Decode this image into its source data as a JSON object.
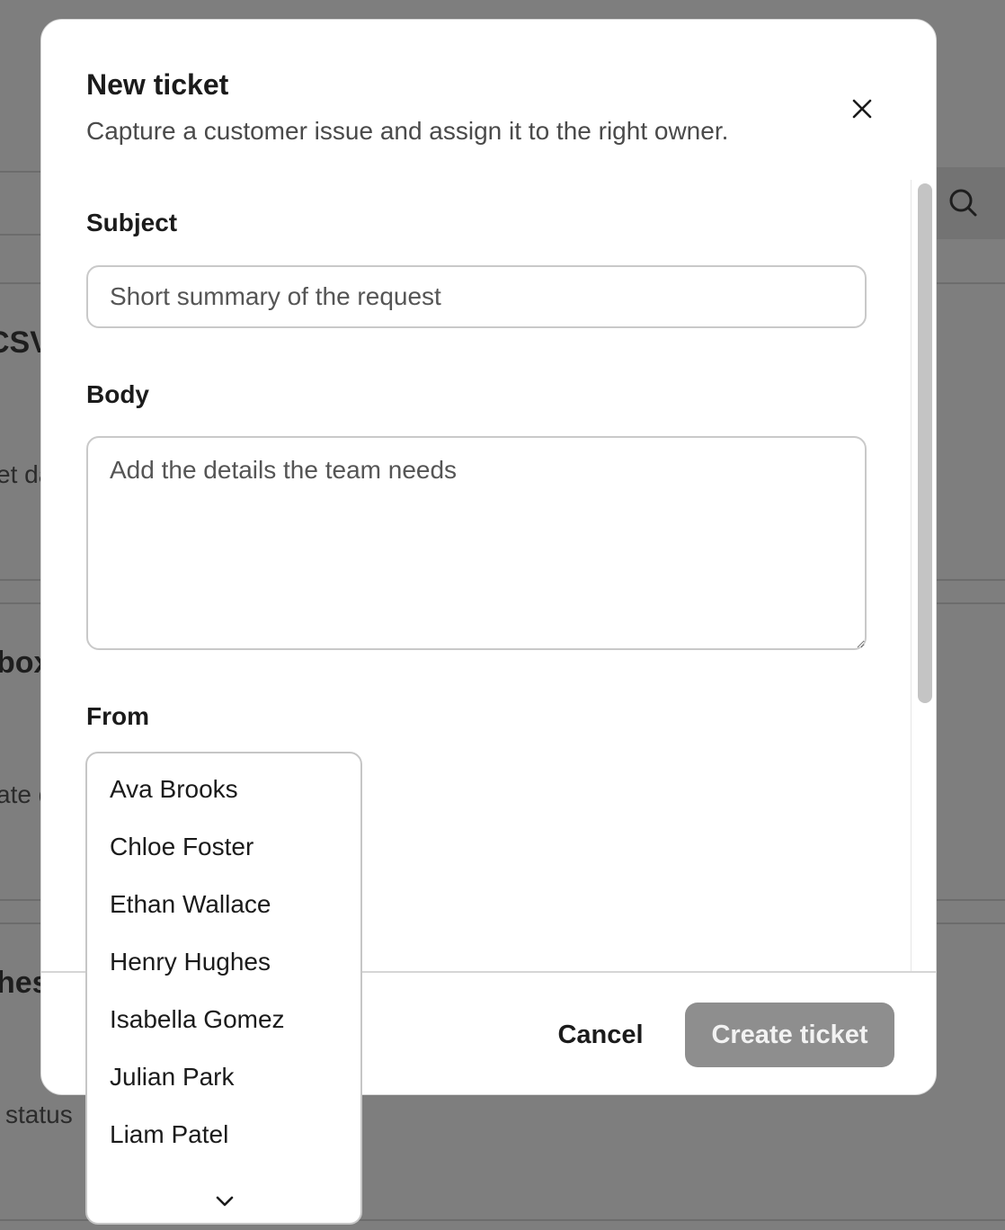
{
  "background": {
    "fragments": [
      "CSV",
      "et da",
      "box",
      "ate d",
      "hes",
      "status"
    ]
  },
  "modal": {
    "title": "New ticket",
    "subtitle": "Capture a customer issue and assign it to the right owner.",
    "close_icon": "close-icon"
  },
  "form": {
    "subject": {
      "label": "Subject",
      "value": "",
      "placeholder": "Short summary of the request"
    },
    "body": {
      "label": "Body",
      "value": "",
      "placeholder": "Add the details the team needs"
    },
    "from": {
      "label": "From",
      "options": [
        "Ava Brooks",
        "Chloe Foster",
        "Ethan Wallace",
        "Henry Hughes",
        "Isabella Gomez",
        "Julian Park",
        "Liam Patel"
      ],
      "more_icon": "chevron-down-icon"
    }
  },
  "footer": {
    "cancel_label": "Cancel",
    "create_label": "Create ticket"
  },
  "colors": {
    "overlay": "#7e7e7e",
    "primary_disabled": "#8e8e8e"
  }
}
